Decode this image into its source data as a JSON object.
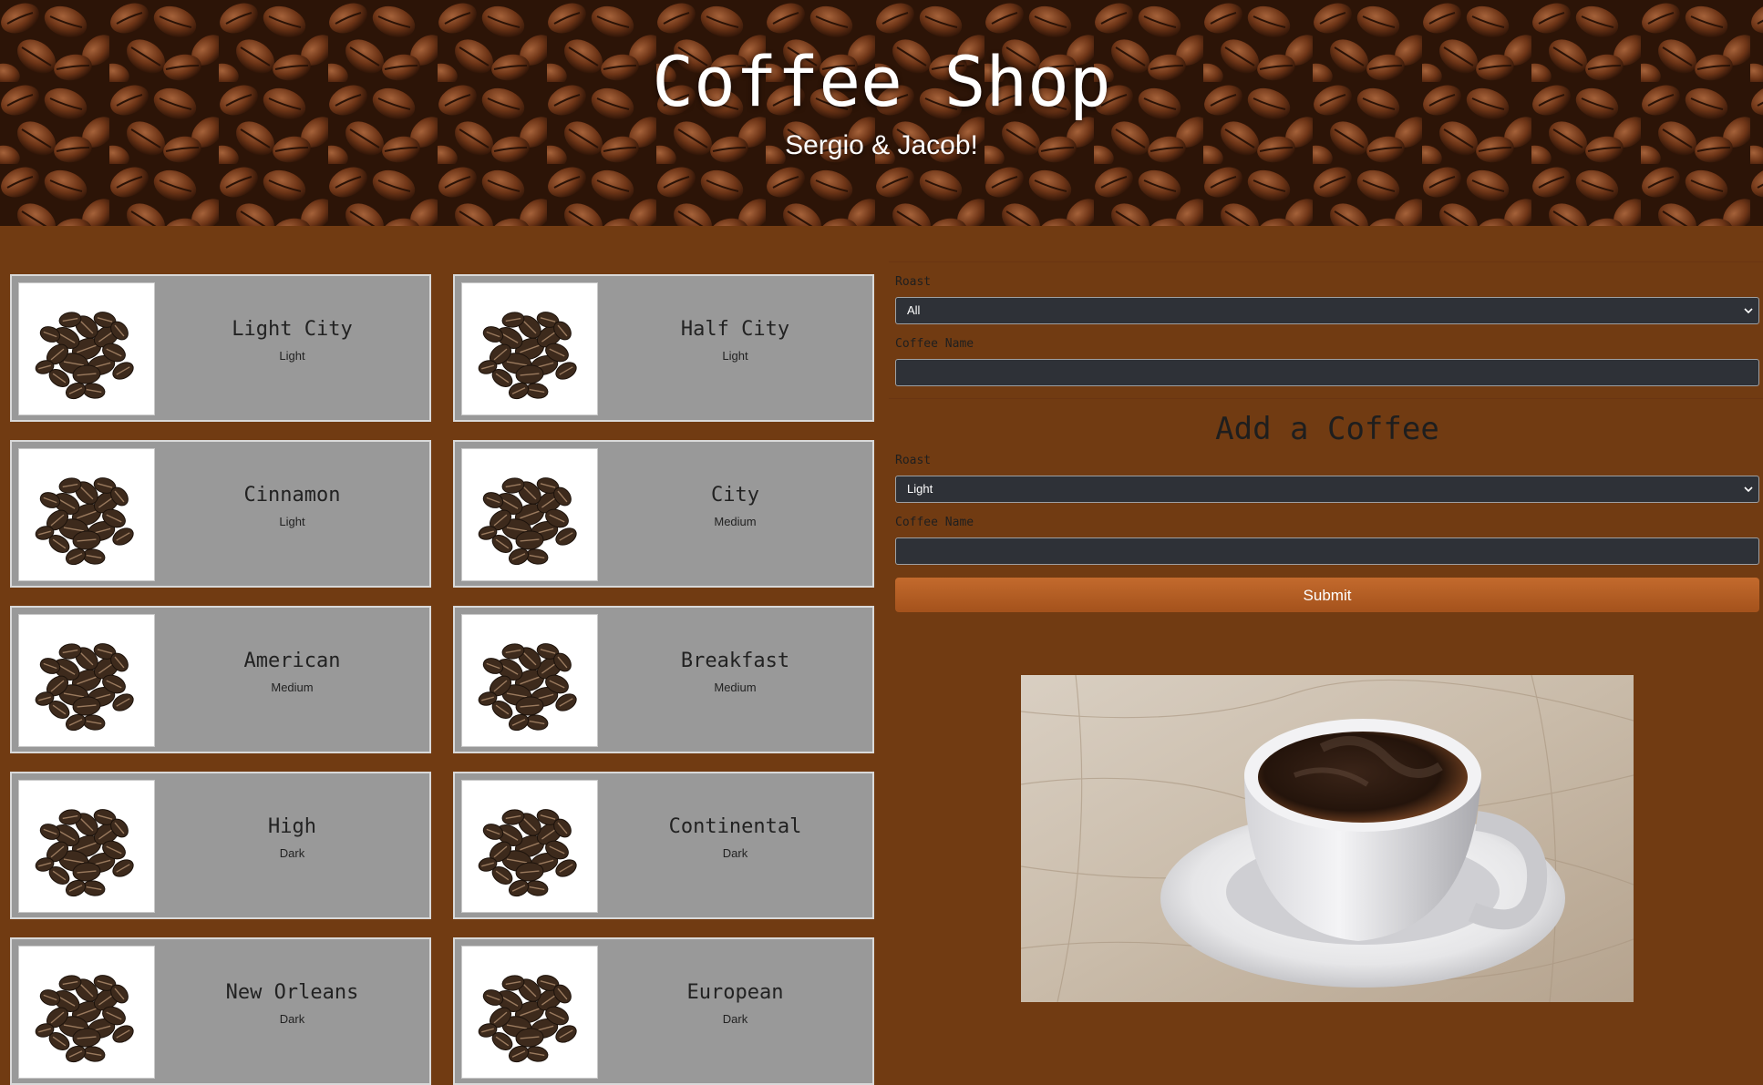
{
  "header": {
    "title": "Coffee Shop",
    "subtitle": "Sergio & Jacob!"
  },
  "coffees": [
    {
      "name": "Light City",
      "roast": "Light"
    },
    {
      "name": "Half City",
      "roast": "Light"
    },
    {
      "name": "Cinnamon",
      "roast": "Light"
    },
    {
      "name": "City",
      "roast": "Medium"
    },
    {
      "name": "American",
      "roast": "Medium"
    },
    {
      "name": "Breakfast",
      "roast": "Medium"
    },
    {
      "name": "High",
      "roast": "Dark"
    },
    {
      "name": "Continental",
      "roast": "Dark"
    },
    {
      "name": "New Orleans",
      "roast": "Dark"
    },
    {
      "name": "European",
      "roast": "Dark"
    }
  ],
  "filter_form": {
    "roast_label": "Roast",
    "roast_value": "All",
    "name_label": "Coffee Name",
    "name_value": ""
  },
  "add_form": {
    "heading": "Add a Coffee",
    "roast_label": "Roast",
    "roast_value": "Light",
    "name_label": "Coffee Name",
    "name_value": "",
    "submit_label": "Submit"
  },
  "colors": {
    "page_background": "#713b12",
    "card_background": "#999999",
    "input_background": "#2e3137",
    "submit_button": "#b55f23"
  },
  "icons": {
    "coffee_thumbnail": "coffee-beans-icon",
    "select_arrow": "chevron-down-icon"
  }
}
